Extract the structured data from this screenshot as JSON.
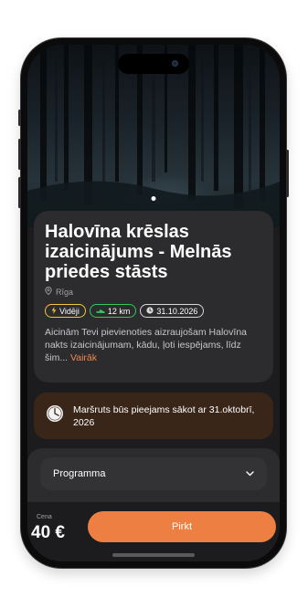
{
  "event": {
    "title": "Halovīna krēslas izaicinājums - Melnās priedes stāsts",
    "location": "Rīga",
    "tags": [
      {
        "label": "Vidēji",
        "icon": "lightning-icon",
        "color": "#f2c53d"
      },
      {
        "label": "12 km",
        "icon": "shoe-icon",
        "color": "#34c759"
      },
      {
        "label": "31.10.2026",
        "icon": "clock-icon",
        "color": "#d8d8d8"
      }
    ],
    "description": "Aicinām Tevi pievienoties aizraujošam Halovīna nakts izaicinājumam, kādu, ļoti iespējams, līdz šim...",
    "more_label": "Vairāk"
  },
  "notice": {
    "text": "Maršruts būs pieejams sākot ar 31.oktobrī, 2026",
    "icon": "clock-icon"
  },
  "sections": {
    "program_label": "Programma",
    "chevron": "chevron-down-icon"
  },
  "purchase": {
    "price_label": "Cena",
    "price": "40 €",
    "buy_label": "Pirkt"
  },
  "colors": {
    "accent": "#ee7f42",
    "card": "#2c2c2e",
    "notice_bg": "#3a2619"
  },
  "carousel": {
    "current": 1,
    "total": 1
  }
}
